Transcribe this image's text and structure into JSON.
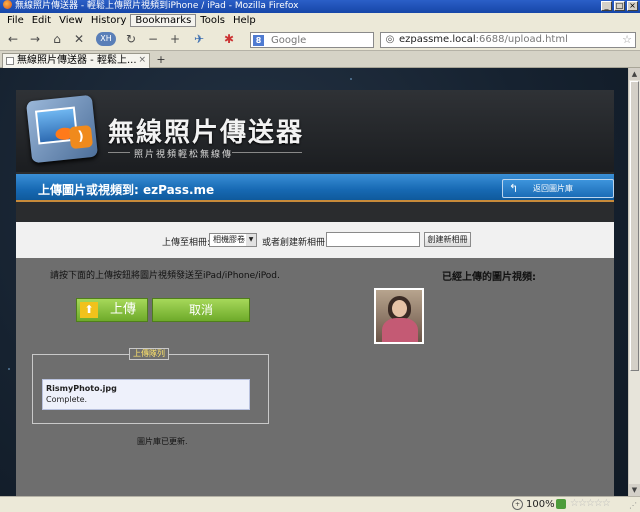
{
  "window": {
    "title": "無線照片傳送器 - 輕鬆上傳照片視頻到iPhone / iPad - Mozilla Firefox",
    "minimize": "_",
    "maximize": "□",
    "close": "×"
  },
  "menu": {
    "items": [
      "File",
      "Edit",
      "View",
      "History",
      "Bookmarks",
      "Tools",
      "Help"
    ]
  },
  "nav": {
    "back": "←",
    "forward": "→",
    "home": "⌂",
    "stop": "✕",
    "reload": "↻",
    "minus": "−",
    "plus": "+",
    "search_engine": "8",
    "search_placeholder": "Google",
    "url_host": "ezpassme.local",
    "url_rest": ":6688/upload.html",
    "star": "☆"
  },
  "tabs": {
    "active": "無線照片傳送器 - 輕鬆上...",
    "close": "×",
    "new_tab": "+"
  },
  "app": {
    "title": "無線照片傳送器",
    "subtitle": "照片視頻輕松無線傳",
    "upload_to": "上傳圖片或視頻到: ezPass.me",
    "back_button": "返回圖片庫",
    "back_arrow": "↰",
    "album": {
      "label": "上傳至相冊:",
      "selected": "相機膠卷",
      "or_create_label": "或者創建新相冊:",
      "create_button": "創建新相冊"
    },
    "instruction": "請按下面的上傳按鈕將圖片視頻發送至iPad/iPhone/iPod.",
    "upload_button": "上傳",
    "cancel_button": "取消",
    "queue": {
      "label": "上傳隊列",
      "filename": "RismyPhoto.jpg",
      "status": "Complete."
    },
    "library_status": "圖片庫已更新.",
    "uploaded_title": "已經上傳的圖片視頻:"
  },
  "status": {
    "zoom": "100%",
    "zoom_glyph": "🔍",
    "stars": "☆☆☆☆☆"
  }
}
